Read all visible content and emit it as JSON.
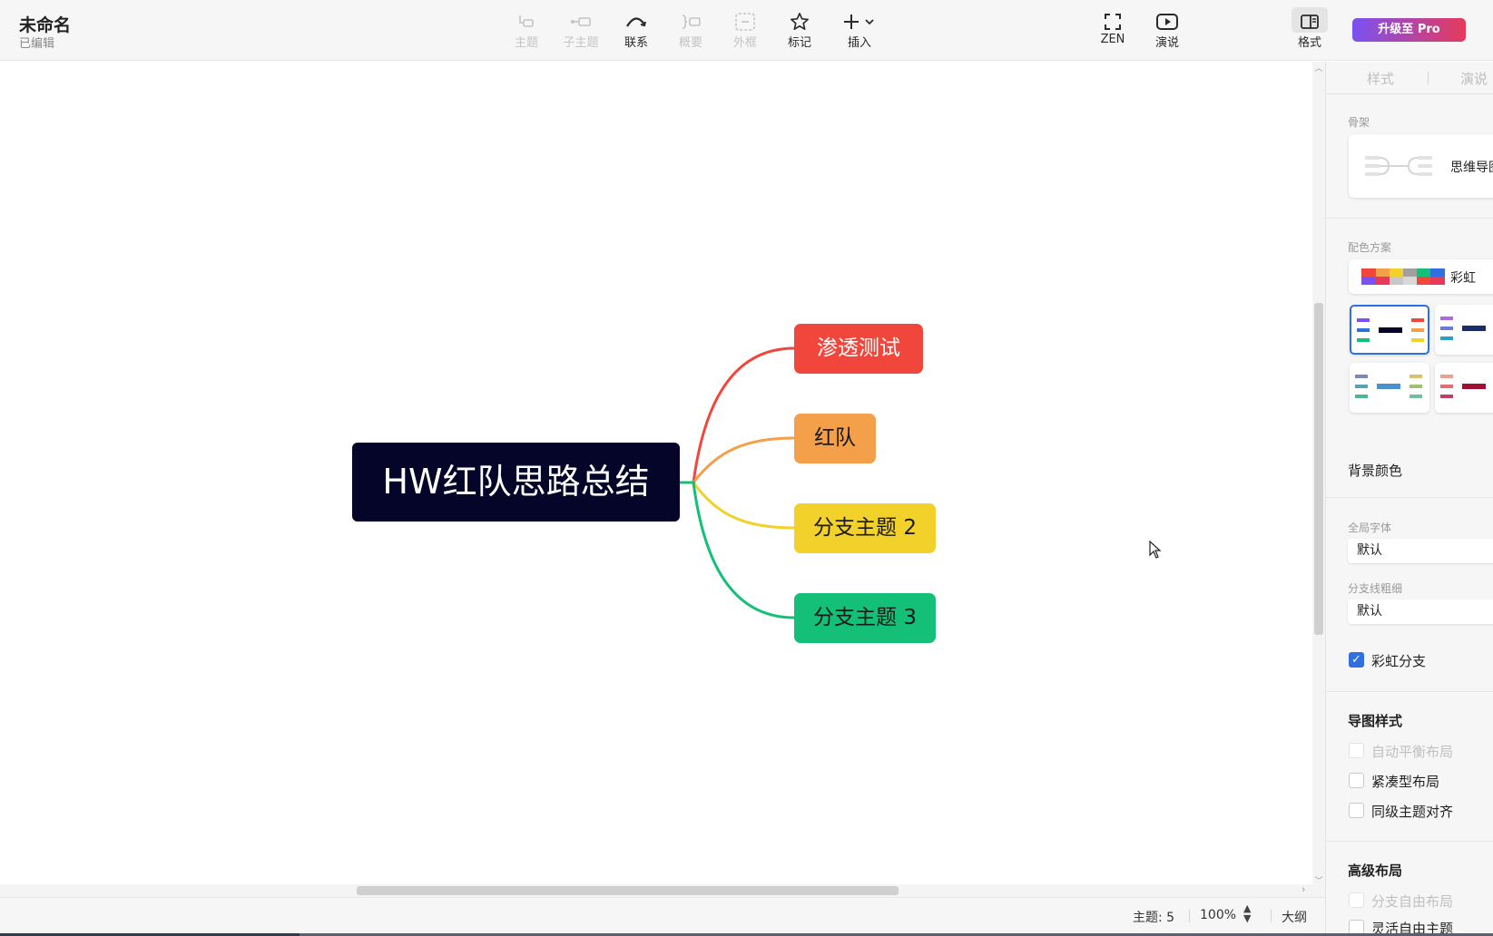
{
  "header": {
    "doc_title": "未命名",
    "doc_status": "已编辑",
    "tools": [
      {
        "label": "主题",
        "icon": "topic-icon",
        "enabled": false
      },
      {
        "label": "子主题",
        "icon": "subtopic-icon",
        "enabled": false
      },
      {
        "label": "联系",
        "icon": "relationship-icon",
        "enabled": true
      },
      {
        "label": "概要",
        "icon": "summary-icon",
        "enabled": false
      },
      {
        "label": "外框",
        "icon": "boundary-icon",
        "enabled": false
      },
      {
        "label": "标记",
        "icon": "star-icon",
        "enabled": true
      },
      {
        "label": "插入",
        "icon": "plus-icon",
        "enabled": true
      }
    ],
    "zen_label": "ZEN",
    "pitch_label": "演说",
    "format_label": "格式",
    "upgrade_label": "升级至 Pro"
  },
  "map": {
    "central_topic": "HW红队思路总结",
    "branches": [
      {
        "label": "渗透测试",
        "color": "#f0463c"
      },
      {
        "label": "红队",
        "color": "#f4a04a"
      },
      {
        "label": "分支主题 2",
        "color": "#f2d12a"
      },
      {
        "label": "分支主题 3",
        "color": "#14c078"
      }
    ]
  },
  "status_bar": {
    "topics": "主题: 5",
    "zoom": "100%",
    "outline": "大纲"
  },
  "panel": {
    "tabs": [
      "样式",
      "演说"
    ],
    "skeleton_label": "骨架",
    "skeleton_name": "思维导图",
    "palette_label": "配色方案",
    "palette_name": "彩虹",
    "background_label": "背景颜色",
    "font_label": "全局字体",
    "font_value": "默认",
    "line_width_label": "分支线粗细",
    "line_width_value": "默认",
    "rainbow_branch_label": "彩虹分支",
    "rainbow_branch_checked": true,
    "map_style_title": "导图样式",
    "map_style_options": [
      {
        "label": "自动平衡布局",
        "enabled": false,
        "checked": false
      },
      {
        "label": "紧凑型布局",
        "enabled": true,
        "checked": false
      },
      {
        "label": "同级主题对齐",
        "enabled": true,
        "checked": false
      }
    ],
    "advanced_title": "高级布局",
    "advanced_options": [
      {
        "label": "分支自由布局",
        "enabled": false,
        "checked": false
      },
      {
        "label": "灵活自由主题",
        "enabled": true,
        "checked": false
      }
    ]
  },
  "colors": {
    "accent": "#2f6fe0",
    "central_topic_bg": "#05052a",
    "pro_gradient_start": "#7a52f2",
    "pro_gradient_end": "#e63a5b"
  }
}
